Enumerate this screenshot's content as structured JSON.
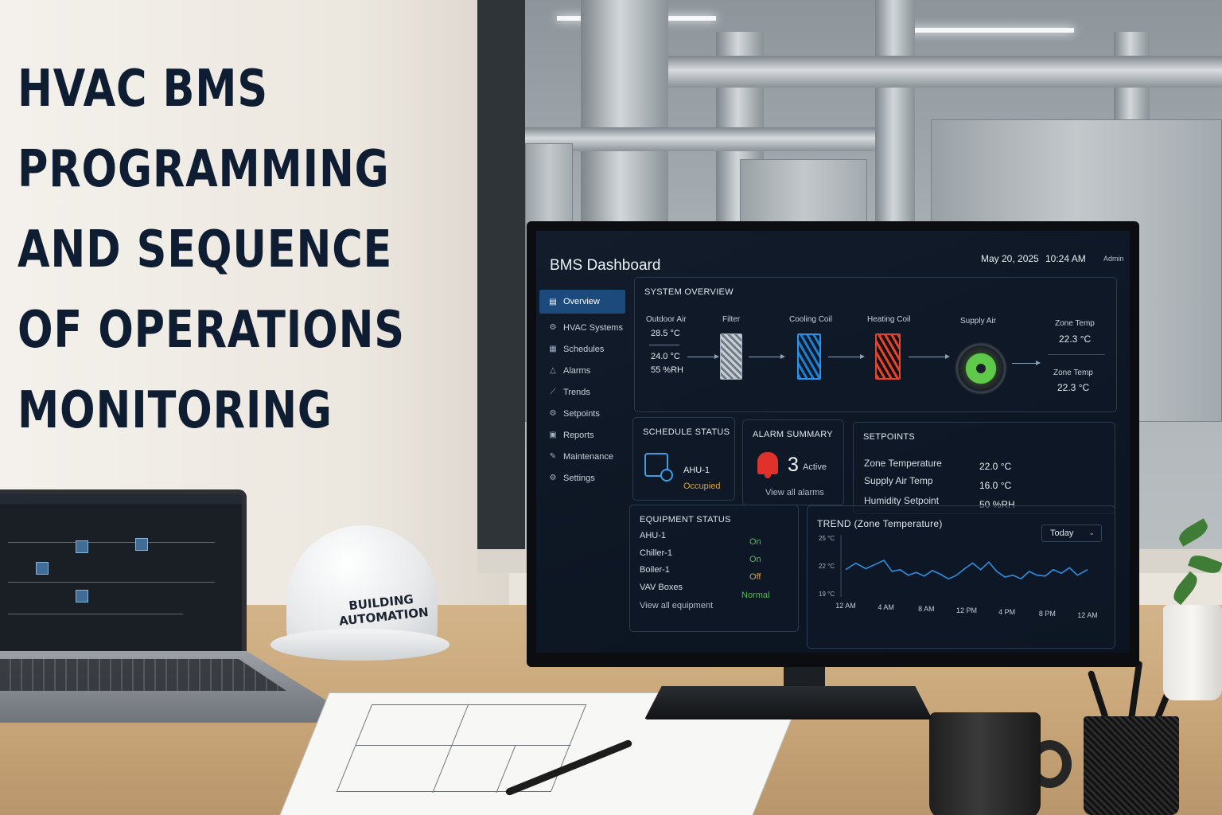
{
  "headline": {
    "lines": [
      "HVAC BMS",
      "PROGRAMMING",
      "AND SEQUENCE",
      "OF OPERATIONS",
      "MONITORING"
    ]
  },
  "hardhat": {
    "line1": "BUILDING",
    "line2": "AUTOMATION"
  },
  "dashboard": {
    "title": "BMS Dashboard",
    "date": "May 20, 2025",
    "time": "10:24 AM",
    "user": "Admin",
    "accent": "#1d4a7c",
    "nav": [
      {
        "label": "Overview",
        "icon": "clipboard-icon"
      },
      {
        "label": "HVAC Systems",
        "icon": "gear-network-icon"
      },
      {
        "label": "Schedules",
        "icon": "calendar-icon"
      },
      {
        "label": "Alarms",
        "icon": "warning-icon"
      },
      {
        "label": "Trends",
        "icon": "trend-icon"
      },
      {
        "label": "Setpoints",
        "icon": "gear-icon"
      },
      {
        "label": "Reports",
        "icon": "report-icon"
      },
      {
        "label": "Maintenance",
        "icon": "wrench-icon"
      },
      {
        "label": "Settings",
        "icon": "settings-icon"
      }
    ],
    "system_overview": {
      "title": "SYSTEM OVERVIEW",
      "outdoor_air": {
        "label": "Outdoor Air",
        "temp": "28.5 °C",
        "mixed_temp": "24.0 °C",
        "humidity": "55 %RH"
      },
      "filter": "Filter",
      "cooling_coil": "Cooling Coil",
      "heating_coil": "Heating Coil",
      "supply_air": "Supply Air",
      "zone_temp_1": {
        "label": "Zone Temp",
        "value": "22.3 °C"
      },
      "zone_temp_2": {
        "label": "Zone Temp",
        "value": "22.3 °C"
      }
    },
    "schedule": {
      "title": "SCHEDULE STATUS",
      "unit": "AHU-1",
      "state": "Occupied"
    },
    "alarm": {
      "title": "ALARM SUMMARY",
      "count": "3",
      "active": "Active",
      "link": "View all alarms"
    },
    "setpoints": {
      "title": "SETPOINTS",
      "items": [
        {
          "name": "Zone Temperature",
          "value": "22.0 °C"
        },
        {
          "name": "Supply Air Temp",
          "value": "16.0 °C"
        },
        {
          "name": "Humidity Setpoint",
          "value": "50 %RH"
        }
      ]
    },
    "equipment": {
      "title": "EQUIPMENT STATUS",
      "items": [
        {
          "name": "AHU-1",
          "state": "On",
          "color": "#4fbf4a"
        },
        {
          "name": "Chiller-1",
          "state": "On",
          "color": "#4fbf4a"
        },
        {
          "name": "Boiler-1",
          "state": "Off",
          "color": "#d9a441"
        },
        {
          "name": "VAV Boxes",
          "state": "Normal",
          "color": "#4fbf4a"
        }
      ],
      "link": "View all equipment"
    },
    "trend": {
      "title": "TREND (Zone Temperature)",
      "range": "Today",
      "line_color": "#2f8fe0"
    }
  },
  "chart_data": {
    "type": "line",
    "title": "TREND (Zone Temperature)",
    "x_tick_labels": [
      "12 AM",
      "4 AM",
      "8 AM",
      "12 PM",
      "4 PM",
      "8 PM",
      "12 AM"
    ],
    "y_tick_labels": [
      "25 °C",
      "22 °C",
      "19 °C"
    ],
    "ylim": [
      19,
      25
    ],
    "xlim": [
      0,
      24
    ],
    "series": [
      {
        "x": [
          0,
          1,
          2,
          3,
          3.8,
          4.6,
          5.4,
          6.2,
          7,
          7.8,
          8.6,
          9.4,
          10.2,
          11,
          11.8,
          12.6,
          13.4,
          14.2,
          15,
          15.8,
          16.6,
          17.4,
          18.2,
          19,
          19.8,
          20.6,
          21.4,
          22.2,
          23,
          24
        ],
        "y": [
          21.6,
          22.3,
          21.7,
          22.2,
          22.6,
          21.4,
          21.6,
          21.0,
          21.3,
          20.9,
          21.5,
          21.1,
          20.6,
          21.0,
          21.7,
          22.3,
          21.6,
          22.4,
          21.4,
          20.8,
          21.0,
          20.6,
          21.4,
          21.0,
          20.9,
          21.6,
          21.2,
          21.8,
          21.0,
          21.6
        ]
      }
    ],
    "grid": false
  }
}
